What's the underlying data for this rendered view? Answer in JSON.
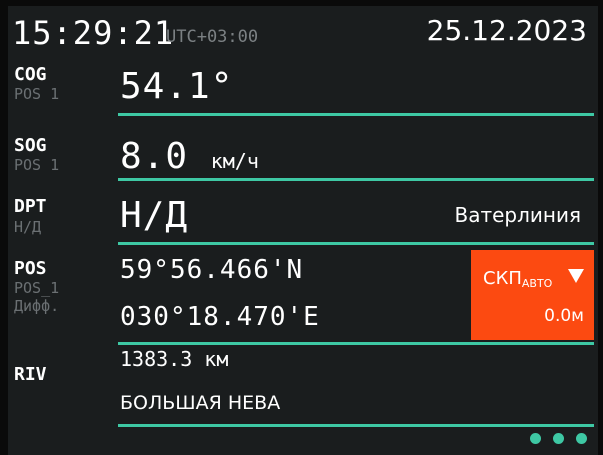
{
  "header": {
    "time": "15:29:21",
    "timezone": "UTC+03:00",
    "date": "25.12.2023"
  },
  "cog": {
    "label": "COG",
    "source": "POS 1",
    "value": "54.1°"
  },
  "sog": {
    "label": "SOG",
    "source": "POS 1",
    "value": "8.0",
    "unit": "км/ч"
  },
  "dpt": {
    "label": "DPT",
    "source": "Н/Д",
    "value": "Н/Д",
    "reference": "Ватерлиния"
  },
  "pos": {
    "label": "POS",
    "source": "POS_1",
    "mode": "Дифф.",
    "latitude": "59°56.466'N",
    "longitude": "030°18.470'E",
    "skp": {
      "title": "СКП",
      "sub": "АВТО",
      "value": "0.0м"
    }
  },
  "riv": {
    "label": "RIV",
    "distance": "1383.3",
    "unit": "км",
    "name": "БОЛЬШАЯ НЕВА"
  },
  "colors": {
    "accent": "#3ec8a4",
    "alert_box": "#fc4a11",
    "background": "#1a1d1e",
    "muted": "#6b7073"
  },
  "icons": {
    "more": "more-dots-icon",
    "dropdown": "triangle-down-icon"
  }
}
